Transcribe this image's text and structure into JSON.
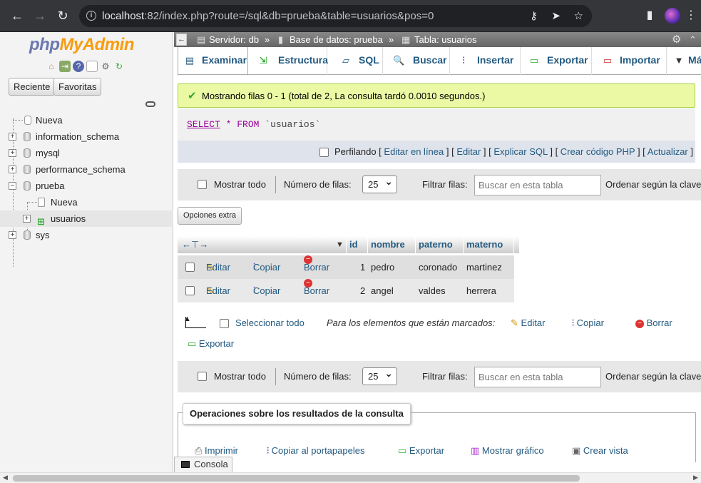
{
  "browser": {
    "url_host": "localhost",
    "url_rest": ":82/index.php?route=/sql&db=prueba&table=usuarios&pos=0"
  },
  "sidebar": {
    "logo_a": "php",
    "logo_b": "MyAdmin",
    "recent": "Reciente",
    "favorites": "Favoritas",
    "tree": [
      {
        "label": "Nueva"
      },
      {
        "label": "information_schema"
      },
      {
        "label": "mysql"
      },
      {
        "label": "performance_schema"
      },
      {
        "label": "prueba"
      },
      {
        "label": "Nueva"
      },
      {
        "label": "usuarios"
      },
      {
        "label": "sys"
      }
    ]
  },
  "breadcrumb": {
    "server": "Servidor: db",
    "sep1": "»",
    "database": "Base de datos: prueba",
    "sep2": "»",
    "table": "Tabla: usuarios"
  },
  "tabs": [
    "Examinar",
    "Estructura",
    "SQL",
    "Buscar",
    "Insertar",
    "Exportar",
    "Importar",
    "Más"
  ],
  "success_msg": "Mostrando filas 0 - 1 (total de 2, La consulta tardó 0.0010 segundos.)",
  "sql": {
    "kw1": "SELECT",
    "star": "*",
    "kw2": "FROM",
    "table": "`usuarios`"
  },
  "profiling": {
    "label": "Perfilando",
    "edit_inline": "Editar en línea",
    "edit": "Editar",
    "explain": "Explicar SQL",
    "create_php": "Crear código PHP",
    "refresh": "Actualizar"
  },
  "nav": {
    "show_all": "Mostrar todo",
    "rows_label": "Número de filas:",
    "rows_value": "25",
    "filter_label": "Filtrar filas:",
    "filter_placeholder": "Buscar en esta tabla",
    "sort_label": "Ordenar según la clave"
  },
  "extra_options": "Opciones extra",
  "table": {
    "columns": [
      "id",
      "nombre",
      "paterno",
      "materno"
    ],
    "actions": {
      "edit": "Editar",
      "copy": "Copiar",
      "delete": "Borrar"
    },
    "rows": [
      {
        "id": "1",
        "nombre": "pedro",
        "paterno": "coronado",
        "materno": "martinez"
      },
      {
        "id": "2",
        "nombre": "angel",
        "paterno": "valdes",
        "materno": "herrera"
      }
    ]
  },
  "bulk": {
    "select_all": "Seleccionar todo",
    "marked": "Para los elementos que están marcados:",
    "edit": "Editar",
    "copy": "Copiar",
    "delete": "Borrar",
    "export": "Exportar"
  },
  "operations": {
    "legend": "Operaciones sobre los resultados de la consulta",
    "print": "Imprimir",
    "copy_clipboard": "Copiar al portapapeles",
    "export": "Exportar",
    "chart": "Mostrar gráfico",
    "view": "Crear vista"
  },
  "console": "Consola"
}
